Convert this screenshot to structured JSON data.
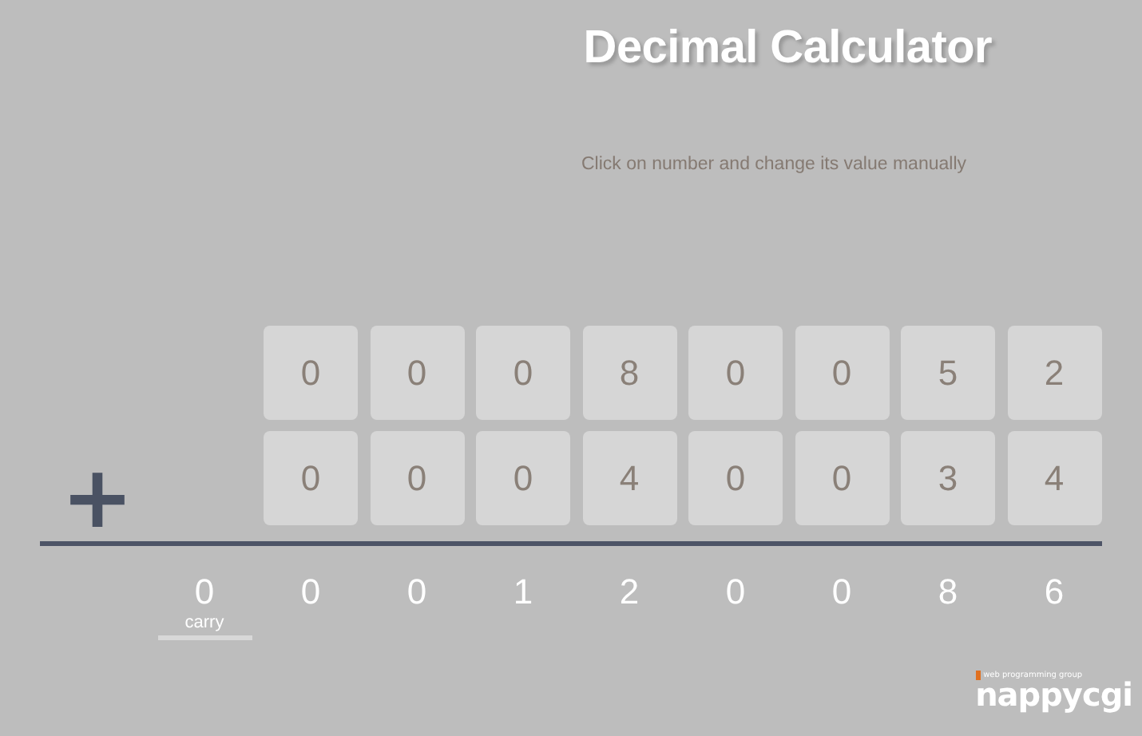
{
  "title": "Decimal Calculator",
  "instruction": "Click on number and change its value manually",
  "operator": "+",
  "operands": [
    {
      "digits": [
        "0",
        "0",
        "0",
        "8",
        "0",
        "0",
        "5",
        "2"
      ]
    },
    {
      "digits": [
        "0",
        "0",
        "0",
        "4",
        "0",
        "0",
        "3",
        "4"
      ]
    }
  ],
  "result": {
    "carry": "0",
    "carry_label": "carry",
    "digits": [
      "0",
      "0",
      "1",
      "2",
      "0",
      "0",
      "8",
      "6"
    ]
  },
  "logo": {
    "tagline": "web programming group",
    "name": "nappycgi"
  }
}
